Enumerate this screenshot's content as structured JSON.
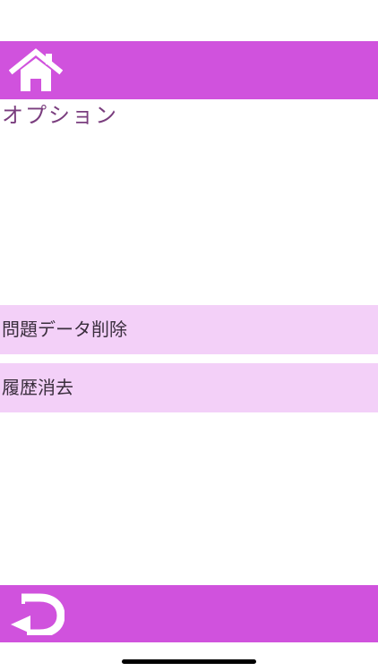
{
  "header": {
    "home_icon": "home-icon",
    "bar_color": "#d052dd"
  },
  "page": {
    "title": "オプション"
  },
  "menu": {
    "items": [
      {
        "label": "問題データ削除"
      },
      {
        "label": "履歴消去"
      }
    ],
    "item_color": "#f3d0f8"
  },
  "footer": {
    "back_icon": "back-arrow-icon",
    "bar_color": "#d052dd"
  }
}
